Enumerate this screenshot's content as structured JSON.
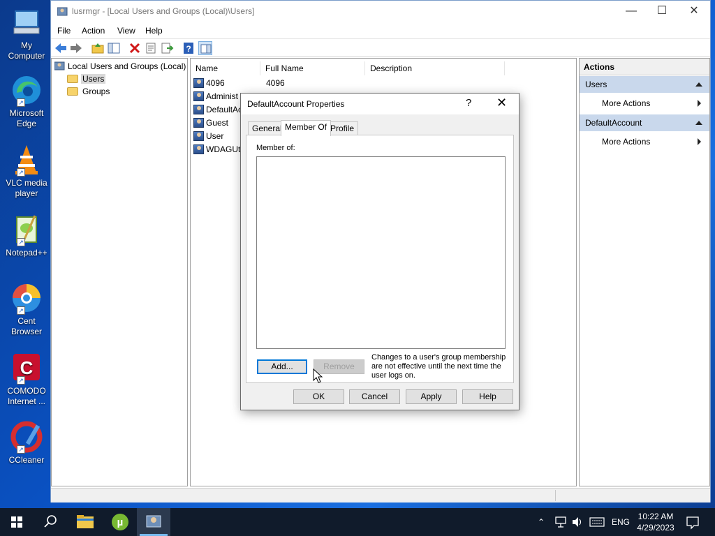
{
  "desktop": {
    "icons": [
      {
        "label": "My Computer",
        "icon": "computer-icon"
      },
      {
        "label": "Microsoft Edge",
        "icon": "edge-icon"
      },
      {
        "label": "VLC media player",
        "icon": "vlc-icon"
      },
      {
        "label": "Notepad++",
        "icon": "notepadpp-icon"
      },
      {
        "label": "Cent Browser",
        "icon": "cent-browser-icon"
      },
      {
        "label": "COMODO Internet ...",
        "icon": "comodo-icon"
      },
      {
        "label": "CCleaner",
        "icon": "ccleaner-icon"
      }
    ]
  },
  "window": {
    "title": "lusrmgr - [Local Users and Groups (Local)\\Users]",
    "controls": {
      "minimize": "—",
      "maximize": "☐",
      "close": "✕"
    },
    "menu": [
      "File",
      "Action",
      "View",
      "Help"
    ],
    "toolbar": [
      "back-icon",
      "forward-icon",
      "up-folder-icon",
      "show-hide-tree-icon",
      "delete-icon",
      "properties-icon",
      "export-icon",
      "help-icon",
      "show-hide-action-pane-icon"
    ]
  },
  "tree": {
    "root": "Local Users and Groups (Local)",
    "items": [
      "Users",
      "Groups"
    ]
  },
  "list": {
    "columns": [
      "Name",
      "Full Name",
      "Description"
    ],
    "rows": [
      {
        "name": "4096",
        "full_name": "4096"
      },
      {
        "name": "Administ",
        "full_name": ""
      },
      {
        "name": "DefaultAc",
        "full_name": ""
      },
      {
        "name": "Guest",
        "full_name": ""
      },
      {
        "name": "User",
        "full_name": ""
      },
      {
        "name": "WDAGUti",
        "full_name": ""
      }
    ]
  },
  "actions": {
    "header": "Actions",
    "sections": [
      {
        "title": "Users",
        "items": [
          "More Actions"
        ]
      },
      {
        "title": "DefaultAccount",
        "items": [
          "More Actions"
        ]
      }
    ]
  },
  "dialog": {
    "title": "DefaultAccount Properties",
    "help": "?",
    "close": "✕",
    "tabs": [
      "General",
      "Member Of",
      "Profile"
    ],
    "active_tab": "Member Of",
    "member_of_label": "Member of:",
    "add_label": "Add...",
    "remove_label": "Remove",
    "note": "Changes to a user's group membership are not effective until the next time the user logs on.",
    "ok_label": "OK",
    "cancel_label": "Cancel",
    "apply_label": "Apply",
    "help_label": "Help"
  },
  "taskbar": {
    "language": "ENG",
    "time": "10:22 AM",
    "date": "4/29/2023"
  },
  "colors": {
    "accent": "#0078d7",
    "action_section": "#c9d8ec",
    "taskbar": "#101b2b"
  }
}
